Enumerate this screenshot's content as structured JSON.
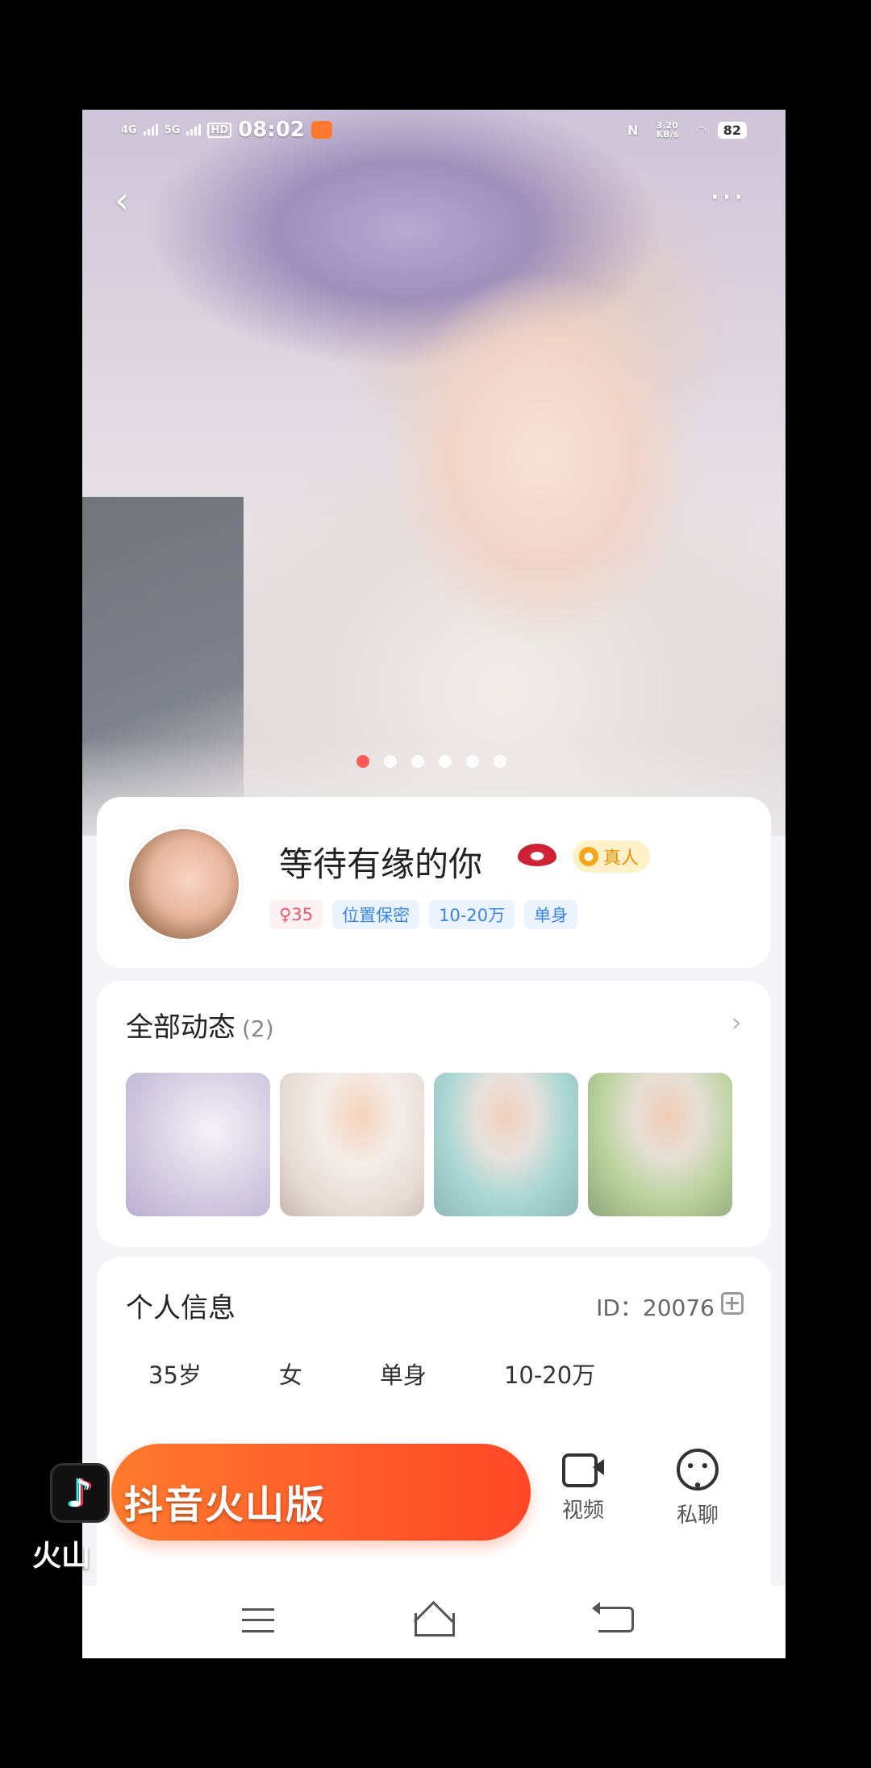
{
  "status_bar": {
    "network_1": "4G",
    "network_2": "5G",
    "hd": "HD",
    "time": "08:02",
    "nfc": "N",
    "speed": "3.20 KB/s",
    "battery": "82"
  },
  "profile": {
    "nickname": "等待有缘的你",
    "verified_label": "真人",
    "tags": [
      "♀35",
      "位置保密",
      "10-20万",
      "单身"
    ]
  },
  "moments": {
    "title": "全部动态",
    "count": "(2)"
  },
  "info": {
    "title": "个人信息",
    "id_label": "ID：20076",
    "items": [
      "35岁",
      "女",
      "单身",
      "10-20万"
    ]
  },
  "actions": {
    "video_label": "视频",
    "chat_label": "私聊"
  },
  "watermark": {
    "logo_glyph": "♪",
    "text": "抖音火山版",
    "sub": "火山"
  },
  "colors": {
    "accent": "#ff5a2a",
    "tag_blue": "#3a86e8",
    "tag_pink": "#f0506a",
    "verify": "#f6a61b"
  },
  "icons": [
    "back-icon",
    "more-icon",
    "lips-icon",
    "copy-icon",
    "video-icon",
    "chat-icon",
    "menu-icon",
    "home-icon",
    "back-nav-icon"
  ]
}
